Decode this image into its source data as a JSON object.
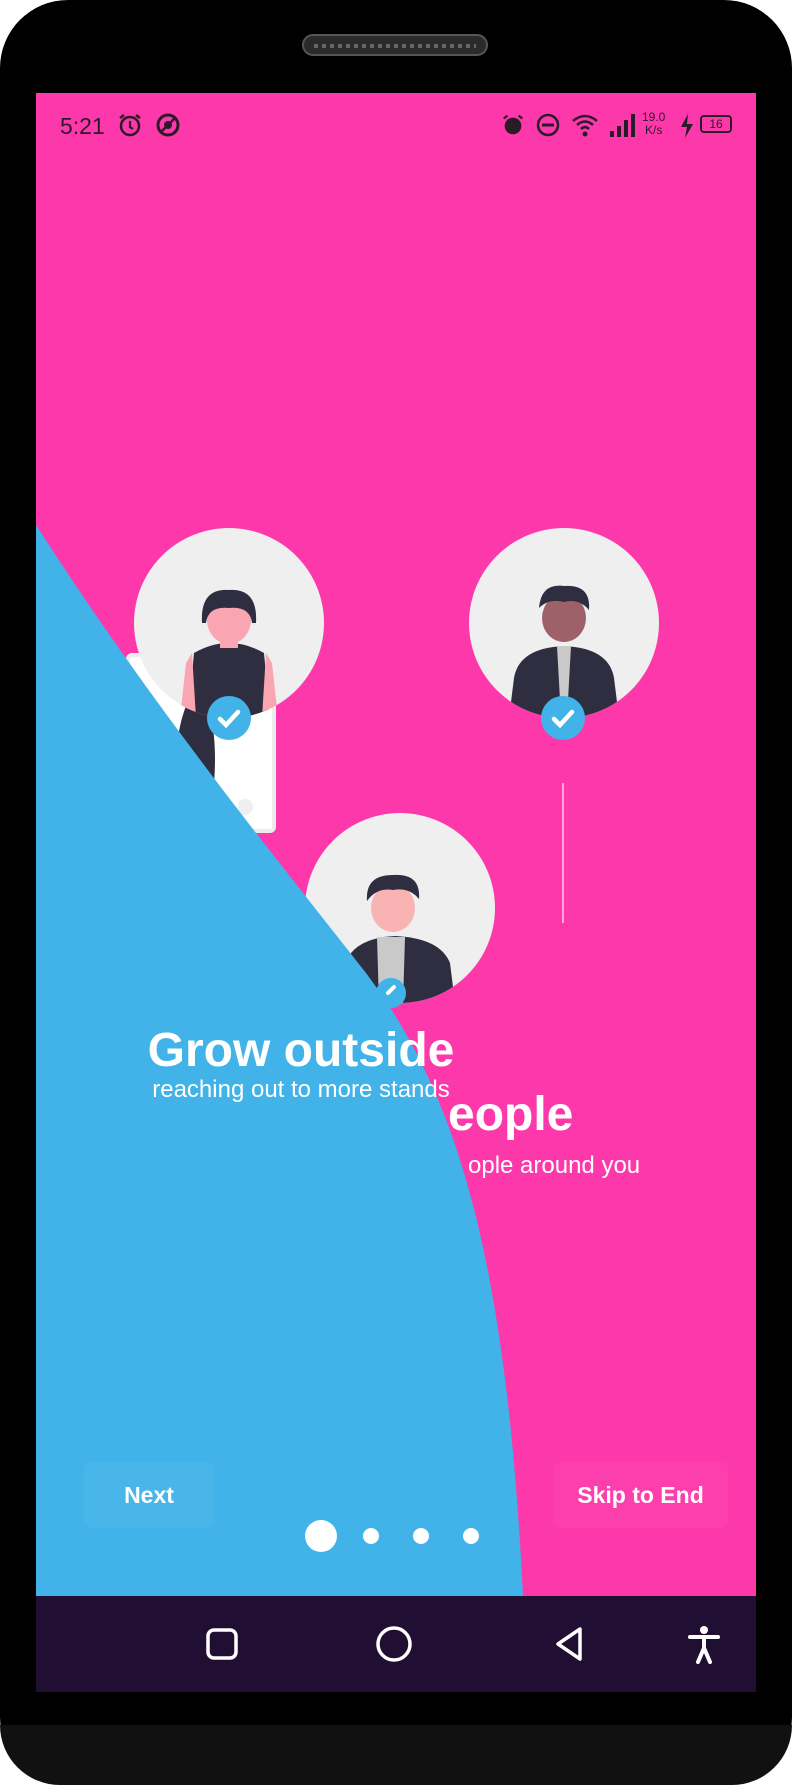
{
  "status_bar": {
    "time": "5:21",
    "speed_value": "19.0",
    "speed_unit": "K/s",
    "battery": "16",
    "icons": [
      "alarm-icon",
      "location-icon",
      "alarm-icon",
      "dnd-icon",
      "wifi-icon",
      "signal-icon",
      "charging-icon",
      "battery-icon"
    ]
  },
  "onboarding": {
    "slide_current": {
      "title": "Grow outside",
      "subtitle": "reaching out to more stands"
    },
    "slide_behind": {
      "title_fragment": "eople",
      "subtitle_fragment": "ople around you"
    }
  },
  "controls": {
    "next_label": "Next",
    "skip_label": "Skip to End",
    "page_count": 4,
    "active_page": 1
  },
  "colors": {
    "pink": "#fd38aa",
    "blue": "#41b3e8",
    "nav_bar": "#200e33"
  },
  "nav_bar": {
    "icons": [
      "recent-apps-icon",
      "home-icon",
      "back-icon",
      "accessibility-icon"
    ]
  }
}
